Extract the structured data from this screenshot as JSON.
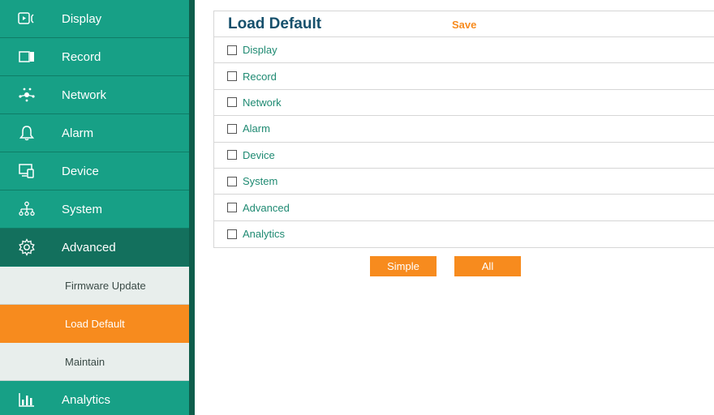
{
  "sidebar": {
    "items": [
      {
        "label": "Display",
        "icon": "display-icon"
      },
      {
        "label": "Record",
        "icon": "record-icon"
      },
      {
        "label": "Network",
        "icon": "network-icon"
      },
      {
        "label": "Alarm",
        "icon": "bell-icon"
      },
      {
        "label": "Device",
        "icon": "device-icon"
      },
      {
        "label": "System",
        "icon": "hierarchy-icon"
      },
      {
        "label": "Advanced",
        "icon": "gear-icon"
      }
    ],
    "advanced_subitems": [
      {
        "label": "Firmware Update"
      },
      {
        "label": "Load Default"
      },
      {
        "label": "Maintain"
      }
    ],
    "bottom_item": {
      "label": "Analytics",
      "icon": "bar-chart-icon"
    }
  },
  "main": {
    "title": "Load Default",
    "save_label": "Save",
    "options": [
      {
        "label": "Display",
        "checked": false
      },
      {
        "label": "Record",
        "checked": false
      },
      {
        "label": "Network",
        "checked": false
      },
      {
        "label": "Alarm",
        "checked": false
      },
      {
        "label": "Device",
        "checked": false
      },
      {
        "label": "System",
        "checked": false
      },
      {
        "label": "Advanced",
        "checked": false
      },
      {
        "label": "Analytics",
        "checked": false
      }
    ],
    "simple_label": "Simple",
    "all_label": "All"
  },
  "colors": {
    "menu_teal": "#17a086",
    "menu_active": "#13705d",
    "accent_orange": "#f78b1e",
    "title_blue": "#16506c"
  }
}
